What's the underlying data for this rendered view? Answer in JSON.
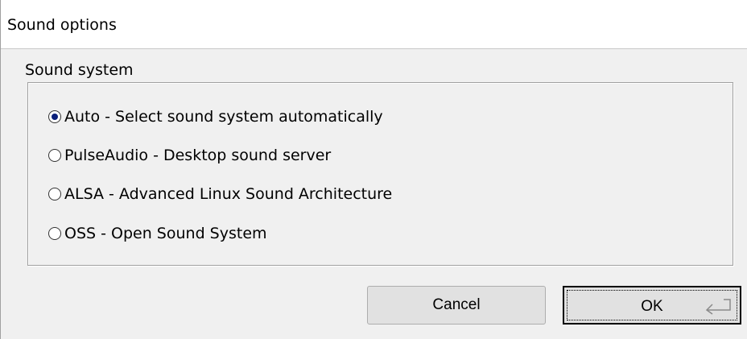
{
  "window": {
    "title": "Sound options"
  },
  "group": {
    "legend": "Sound system",
    "options": [
      {
        "label": "Auto - Select sound system automatically",
        "checked": true
      },
      {
        "label": "PulseAudio - Desktop sound server",
        "checked": false
      },
      {
        "label": "ALSA - Advanced Linux Sound Architecture",
        "checked": false
      },
      {
        "label": "OSS - Open Sound System",
        "checked": false
      }
    ]
  },
  "buttons": {
    "cancel_label": "Cancel",
    "ok_label": "OK",
    "ok_icon": "enter-key-icon"
  },
  "colors": {
    "window_bg": "#f0f0f0",
    "title_bg": "#ffffff",
    "radio_dot": "#0a1f7a",
    "button_bg": "#e1e1e1"
  }
}
